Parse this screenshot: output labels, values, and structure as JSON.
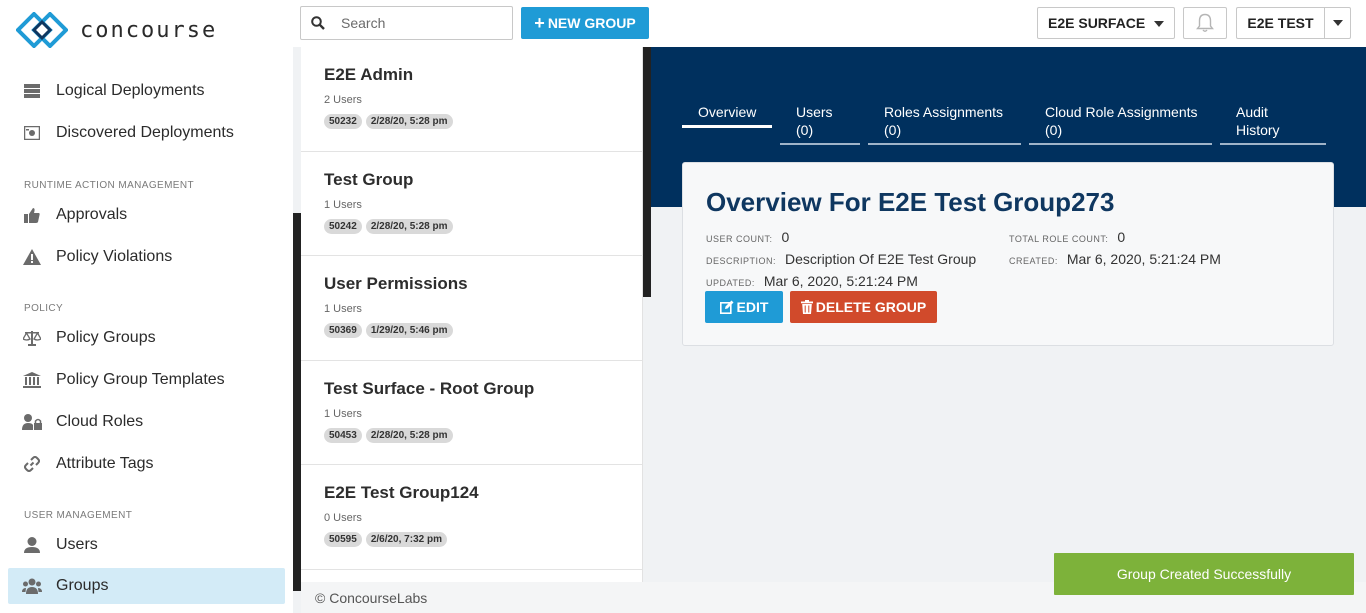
{
  "app": {
    "brand": "concourse"
  },
  "sidebar": {
    "items": [
      {
        "label": "Logical Deployments",
        "icon": "server-icon"
      },
      {
        "label": "Discovered Deployments",
        "icon": "discovered-icon"
      },
      {
        "label": "Approvals",
        "icon": "thumbs-up-icon"
      },
      {
        "label": "Policy Violations",
        "icon": "warning-icon"
      },
      {
        "label": "Policy Groups",
        "icon": "balance-scale-icon"
      },
      {
        "label": "Policy Group Templates",
        "icon": "institution-icon"
      },
      {
        "label": "Cloud Roles",
        "icon": "user-lock-icon"
      },
      {
        "label": "Attribute Tags",
        "icon": "link-icon"
      },
      {
        "label": "Users",
        "icon": "user-icon"
      },
      {
        "label": "Groups",
        "icon": "users-icon"
      }
    ],
    "sections": {
      "runtime": "RUNTIME ACTION MANAGEMENT",
      "policy": "POLICY",
      "user_management": "USER MANAGEMENT"
    },
    "active_item": "Groups"
  },
  "topbar": {
    "search_placeholder": "Search",
    "new_group_label": "NEW GROUP",
    "tenant": "E2E SURFACE",
    "user": "E2E TEST"
  },
  "groups": [
    {
      "name": "E2E Admin",
      "users": "2 Users",
      "id": "50232",
      "date": "2/28/20, 5:28 pm"
    },
    {
      "name": "Test Group",
      "users": "1 Users",
      "id": "50242",
      "date": "2/28/20, 5:28 pm"
    },
    {
      "name": "User Permissions",
      "users": "1 Users",
      "id": "50369",
      "date": "1/29/20, 5:46 pm"
    },
    {
      "name": "Test Surface - Root Group",
      "users": "1 Users",
      "id": "50453",
      "date": "2/28/20, 5:28 pm"
    },
    {
      "name": "E2E Test Group124",
      "users": "0 Users",
      "id": "50595",
      "date": "2/6/20, 7:32 pm"
    }
  ],
  "detail": {
    "tabs": [
      {
        "label": "Overview",
        "count": ""
      },
      {
        "label": "Users",
        "count": "(0)"
      },
      {
        "label": "Roles Assignments",
        "count": "(0)"
      },
      {
        "label": "Cloud Role Assignments",
        "count": "(0)"
      },
      {
        "label": "Audit",
        "count": "History"
      }
    ],
    "title": "Overview For E2E Test Group273",
    "user_count_label": "USER COUNT:",
    "user_count": "0",
    "total_role_count_label": "TOTAL ROLE COUNT:",
    "total_role_count": "0",
    "description_label": "DESCRIPTION:",
    "description": "Description Of E2E Test Group",
    "created_label": "CREATED:",
    "created": "Mar 6, 2020, 5:21:24 PM",
    "updated_label": "UPDATED:",
    "updated": "Mar 6, 2020, 5:21:24 PM",
    "edit_label": "EDIT",
    "delete_label": "DELETE GROUP"
  },
  "footer": {
    "copyright": "© ConcourseLabs"
  },
  "toast": {
    "message": "Group Created Successfully"
  },
  "colors": {
    "accent": "#1f9bd6",
    "header_navy": "#00305e",
    "danger": "#d14a2b",
    "success": "#7db23a",
    "active_nav": "#d3ebf7"
  }
}
